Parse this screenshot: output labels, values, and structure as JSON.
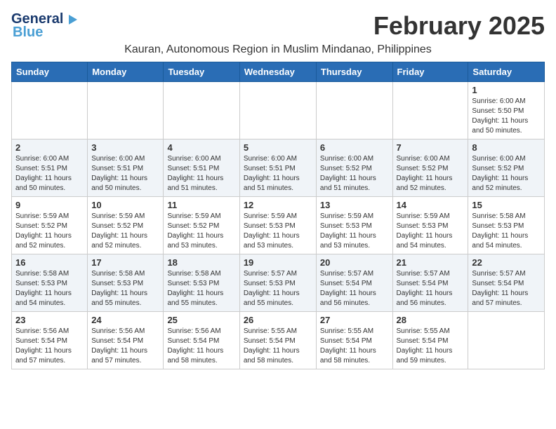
{
  "logo": {
    "general": "General",
    "blue": "Blue",
    "arrow": "▶"
  },
  "title": {
    "month": "February 2025",
    "location": "Kauran, Autonomous Region in Muslim Mindanao, Philippines"
  },
  "days": {
    "headers": [
      "Sunday",
      "Monday",
      "Tuesday",
      "Wednesday",
      "Thursday",
      "Friday",
      "Saturday"
    ]
  },
  "weeks": [
    {
      "cells": [
        {
          "day": "",
          "info": ""
        },
        {
          "day": "",
          "info": ""
        },
        {
          "day": "",
          "info": ""
        },
        {
          "day": "",
          "info": ""
        },
        {
          "day": "",
          "info": ""
        },
        {
          "day": "",
          "info": ""
        },
        {
          "day": "1",
          "info": "Sunrise: 6:00 AM\nSunset: 5:50 PM\nDaylight: 11 hours\nand 50 minutes."
        }
      ]
    },
    {
      "cells": [
        {
          "day": "2",
          "info": "Sunrise: 6:00 AM\nSunset: 5:51 PM\nDaylight: 11 hours\nand 50 minutes."
        },
        {
          "day": "3",
          "info": "Sunrise: 6:00 AM\nSunset: 5:51 PM\nDaylight: 11 hours\nand 50 minutes."
        },
        {
          "day": "4",
          "info": "Sunrise: 6:00 AM\nSunset: 5:51 PM\nDaylight: 11 hours\nand 51 minutes."
        },
        {
          "day": "5",
          "info": "Sunrise: 6:00 AM\nSunset: 5:51 PM\nDaylight: 11 hours\nand 51 minutes."
        },
        {
          "day": "6",
          "info": "Sunrise: 6:00 AM\nSunset: 5:52 PM\nDaylight: 11 hours\nand 51 minutes."
        },
        {
          "day": "7",
          "info": "Sunrise: 6:00 AM\nSunset: 5:52 PM\nDaylight: 11 hours\nand 52 minutes."
        },
        {
          "day": "8",
          "info": "Sunrise: 6:00 AM\nSunset: 5:52 PM\nDaylight: 11 hours\nand 52 minutes."
        }
      ]
    },
    {
      "cells": [
        {
          "day": "9",
          "info": "Sunrise: 5:59 AM\nSunset: 5:52 PM\nDaylight: 11 hours\nand 52 minutes."
        },
        {
          "day": "10",
          "info": "Sunrise: 5:59 AM\nSunset: 5:52 PM\nDaylight: 11 hours\nand 52 minutes."
        },
        {
          "day": "11",
          "info": "Sunrise: 5:59 AM\nSunset: 5:52 PM\nDaylight: 11 hours\nand 53 minutes."
        },
        {
          "day": "12",
          "info": "Sunrise: 5:59 AM\nSunset: 5:53 PM\nDaylight: 11 hours\nand 53 minutes."
        },
        {
          "day": "13",
          "info": "Sunrise: 5:59 AM\nSunset: 5:53 PM\nDaylight: 11 hours\nand 53 minutes."
        },
        {
          "day": "14",
          "info": "Sunrise: 5:59 AM\nSunset: 5:53 PM\nDaylight: 11 hours\nand 54 minutes."
        },
        {
          "day": "15",
          "info": "Sunrise: 5:58 AM\nSunset: 5:53 PM\nDaylight: 11 hours\nand 54 minutes."
        }
      ]
    },
    {
      "cells": [
        {
          "day": "16",
          "info": "Sunrise: 5:58 AM\nSunset: 5:53 PM\nDaylight: 11 hours\nand 54 minutes."
        },
        {
          "day": "17",
          "info": "Sunrise: 5:58 AM\nSunset: 5:53 PM\nDaylight: 11 hours\nand 55 minutes."
        },
        {
          "day": "18",
          "info": "Sunrise: 5:58 AM\nSunset: 5:53 PM\nDaylight: 11 hours\nand 55 minutes."
        },
        {
          "day": "19",
          "info": "Sunrise: 5:57 AM\nSunset: 5:53 PM\nDaylight: 11 hours\nand 55 minutes."
        },
        {
          "day": "20",
          "info": "Sunrise: 5:57 AM\nSunset: 5:54 PM\nDaylight: 11 hours\nand 56 minutes."
        },
        {
          "day": "21",
          "info": "Sunrise: 5:57 AM\nSunset: 5:54 PM\nDaylight: 11 hours\nand 56 minutes."
        },
        {
          "day": "22",
          "info": "Sunrise: 5:57 AM\nSunset: 5:54 PM\nDaylight: 11 hours\nand 57 minutes."
        }
      ]
    },
    {
      "cells": [
        {
          "day": "23",
          "info": "Sunrise: 5:56 AM\nSunset: 5:54 PM\nDaylight: 11 hours\nand 57 minutes."
        },
        {
          "day": "24",
          "info": "Sunrise: 5:56 AM\nSunset: 5:54 PM\nDaylight: 11 hours\nand 57 minutes."
        },
        {
          "day": "25",
          "info": "Sunrise: 5:56 AM\nSunset: 5:54 PM\nDaylight: 11 hours\nand 58 minutes."
        },
        {
          "day": "26",
          "info": "Sunrise: 5:55 AM\nSunset: 5:54 PM\nDaylight: 11 hours\nand 58 minutes."
        },
        {
          "day": "27",
          "info": "Sunrise: 5:55 AM\nSunset: 5:54 PM\nDaylight: 11 hours\nand 58 minutes."
        },
        {
          "day": "28",
          "info": "Sunrise: 5:55 AM\nSunset: 5:54 PM\nDaylight: 11 hours\nand 59 minutes."
        },
        {
          "day": "",
          "info": ""
        }
      ]
    }
  ]
}
